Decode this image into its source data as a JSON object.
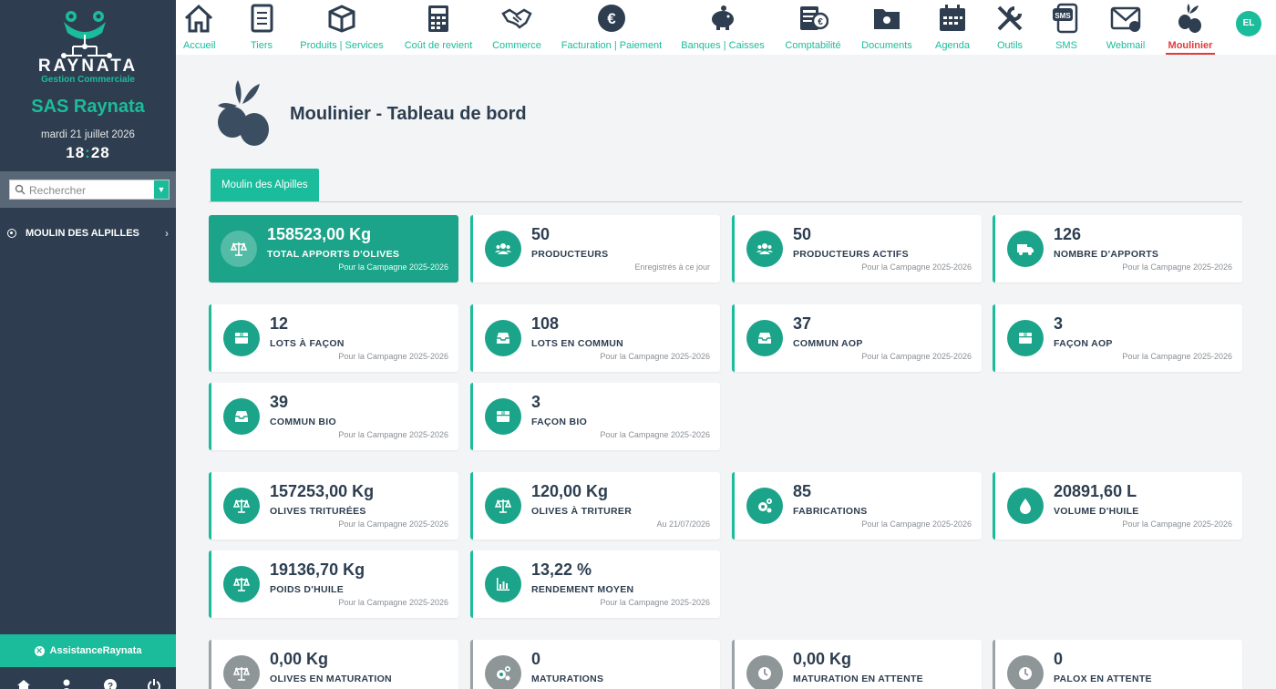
{
  "sidebar": {
    "brand_name": "RAYNATA",
    "brand_sub": "Gestion Commerciale",
    "company": "SAS Raynata",
    "date": "mardi 21 juillet 2026",
    "time_h": "18",
    "time_m": "28",
    "search_placeholder": "Rechercher",
    "menu_item": "MOULIN DES ALPILLES",
    "assist": "AssistanceRaynata"
  },
  "nav": [
    {
      "label": "Accueil",
      "icon": "home-icon"
    },
    {
      "label": "Tiers",
      "icon": "address-book-icon"
    },
    {
      "label": "Produits | Services",
      "icon": "box-icon"
    },
    {
      "label": "Coût de revient",
      "icon": "calculator-icon"
    },
    {
      "label": "Commerce",
      "icon": "handshake-icon"
    },
    {
      "label": "Facturation | Paiement",
      "icon": "euro-icon"
    },
    {
      "label": "Banques | Caisses",
      "icon": "piggy-bank-icon"
    },
    {
      "label": "Comptabilité",
      "icon": "accounting-icon"
    },
    {
      "label": "Documents",
      "icon": "folder-icon"
    },
    {
      "label": "Agenda",
      "icon": "calendar-icon"
    },
    {
      "label": "Outils",
      "icon": "tools-icon"
    },
    {
      "label": "SMS",
      "icon": "sms-icon"
    },
    {
      "label": "Webmail",
      "icon": "mail-icon"
    },
    {
      "label": "Moulinier",
      "icon": "olive-icon"
    }
  ],
  "user_initials": "EL",
  "page": {
    "title": "Moulinier - Tableau de bord",
    "tab": "Moulin des Alpilles"
  },
  "cards": [
    {
      "value": "158523,00 Kg",
      "label": "TOTAL APPORTS D'OLIVES",
      "sub": "Pour la Campagne 2025-2026",
      "icon": "scale-icon",
      "style": "primary"
    },
    {
      "value": "50",
      "label": "PRODUCTEURS",
      "sub": "Enregistrés à ce jour",
      "icon": "users-icon",
      "style": "normal"
    },
    {
      "value": "50",
      "label": "PRODUCTEURS ACTIFS",
      "sub": "Pour la Campagne 2025-2026",
      "icon": "users-icon",
      "style": "normal"
    },
    {
      "value": "126",
      "label": "NOMBRE D'APPORTS",
      "sub": "Pour la Campagne 2025-2026",
      "icon": "truck-icon",
      "style": "normal"
    },
    {
      "value": "12",
      "label": "LOTS À FAÇON",
      "sub": "Pour la Campagne 2025-2026",
      "icon": "box-icon",
      "style": "normal"
    },
    {
      "value": "108",
      "label": "LOTS EN COMMUN",
      "sub": "Pour la Campagne 2025-2026",
      "icon": "inbox-icon",
      "style": "normal"
    },
    {
      "value": "37",
      "label": "COMMUN AOP",
      "sub": "Pour la Campagne 2025-2026",
      "icon": "inbox-icon",
      "style": "normal"
    },
    {
      "value": "3",
      "label": "FAÇON AOP",
      "sub": "Pour la Campagne 2025-2026",
      "icon": "box-icon",
      "style": "normal"
    },
    {
      "value": "39",
      "label": "COMMUN BIO",
      "sub": "Pour la Campagne 2025-2026",
      "icon": "inbox-icon",
      "style": "normal"
    },
    {
      "value": "3",
      "label": "FAÇON BIO",
      "sub": "Pour la Campagne 2025-2026",
      "icon": "box-icon",
      "style": "normal"
    },
    {
      "value": "157253,00 Kg",
      "label": "OLIVES TRITURÉES",
      "sub": "Pour la Campagne 2025-2026",
      "icon": "scale-icon",
      "style": "normal"
    },
    {
      "value": "120,00 Kg",
      "label": "OLIVES À TRITURER",
      "sub": "Au 21/07/2026",
      "icon": "scale-icon",
      "style": "normal"
    },
    {
      "value": "85",
      "label": "FABRICATIONS",
      "sub": "Pour la Campagne 2025-2026",
      "icon": "cogs-icon",
      "style": "normal"
    },
    {
      "value": "20891,60 L",
      "label": "VOLUME D'HUILE",
      "sub": "Pour la Campagne 2025-2026",
      "icon": "drop-icon",
      "style": "normal"
    },
    {
      "value": "19136,70 Kg",
      "label": "POIDS D'HUILE",
      "sub": "Pour la Campagne 2025-2026",
      "icon": "scale-icon",
      "style": "normal"
    },
    {
      "value": "13,22 %",
      "label": "RENDEMENT MOYEN",
      "sub": "Pour la Campagne 2025-2026",
      "icon": "chart-icon",
      "style": "normal"
    },
    {
      "value": "0,00 Kg",
      "label": "OLIVES EN MATURATION",
      "sub": "",
      "icon": "scale-icon",
      "style": "grey"
    },
    {
      "value": "0",
      "label": "MATURATIONS",
      "sub": "",
      "icon": "cogs-icon",
      "style": "grey"
    },
    {
      "value": "0,00 Kg",
      "label": "MATURATION EN ATTENTE",
      "sub": "",
      "icon": "clock-icon",
      "style": "grey"
    },
    {
      "value": "0",
      "label": "PALOX EN ATTENTE",
      "sub": "",
      "icon": "clock-icon",
      "style": "grey"
    }
  ]
}
